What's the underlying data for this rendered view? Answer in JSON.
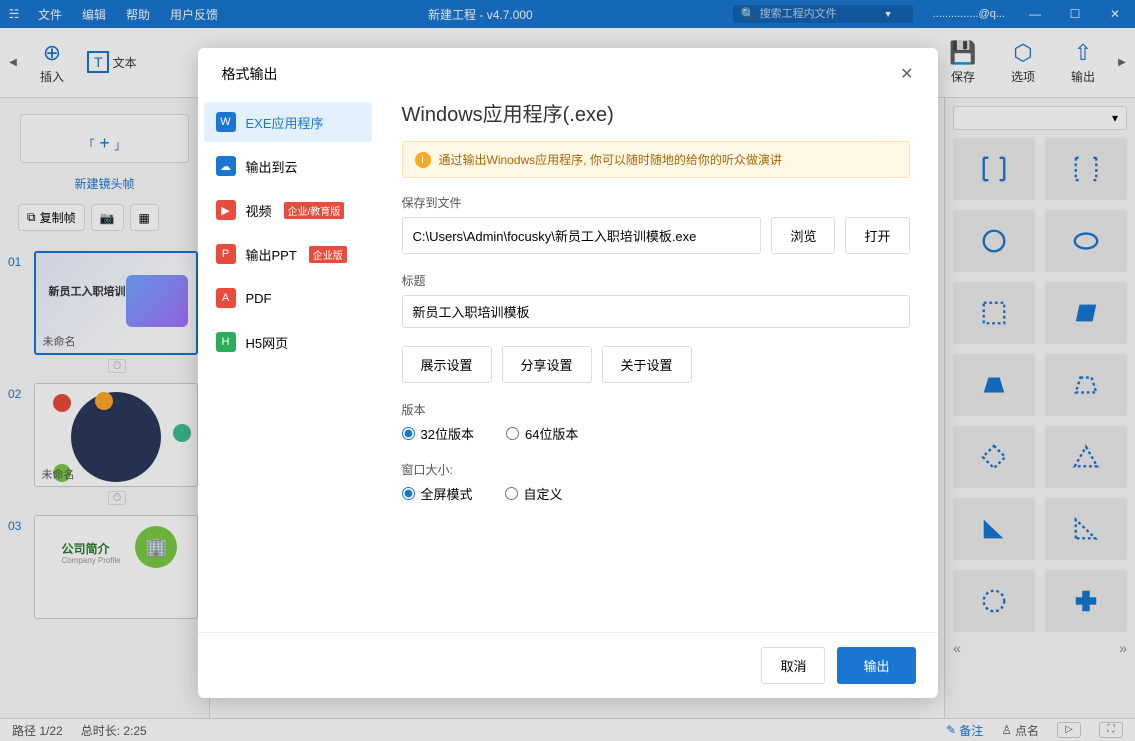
{
  "titlebar": {
    "menus": [
      "文件",
      "编辑",
      "帮助",
      "用户反馈"
    ],
    "title": "新建工程 - v4.7.000",
    "search_placeholder": "搜索工程内文件",
    "user": "...............@q..."
  },
  "toolbar": {
    "items": [
      {
        "icon": "⊕",
        "label": "插入"
      },
      {
        "icon": "T",
        "label": "文本"
      }
    ],
    "right_items": [
      {
        "icon": "💾",
        "label": "保存"
      },
      {
        "icon": "⬡",
        "label": "选项"
      },
      {
        "icon": "⇧",
        "label": "输出"
      }
    ]
  },
  "leftPanel": {
    "new_frame_label": "新建镜头帧",
    "copy_frame_btn": "复制帧",
    "slides": [
      {
        "num": "01",
        "label": "未命名",
        "title": "新员工入职培训"
      },
      {
        "num": "02",
        "label": "未命名"
      },
      {
        "num": "03",
        "title": "公司简介",
        "sub": "Company Profile"
      }
    ]
  },
  "statusbar": {
    "path": "路径 1/22",
    "duration": "总时长: 2:25",
    "remark": "备注",
    "roll": "点名"
  },
  "modal": {
    "header": "格式输出",
    "sidebar": [
      {
        "icon_bg": "#1976d2",
        "icon_txt": "W",
        "label": "EXE应用程序",
        "active": true
      },
      {
        "icon_bg": "#1976d2",
        "icon_txt": "☁",
        "label": "输出到云"
      },
      {
        "icon_bg": "#e84c3d",
        "icon_txt": "▶",
        "label": "视频",
        "tag": "企业/教育版"
      },
      {
        "icon_bg": "#e84c3d",
        "icon_txt": "P",
        "label": "输出PPT",
        "tag": "企业版"
      },
      {
        "icon_bg": "#e84c3d",
        "icon_txt": "A",
        "label": "PDF"
      },
      {
        "icon_bg": "#2aae5b",
        "icon_txt": "H",
        "label": "H5网页"
      }
    ],
    "content": {
      "title": "Windows应用程序(.exe)",
      "banner": "通过输出Winodws应用程序, 你可以随时随地的给你的听众做演讲",
      "save_label": "保存到文件",
      "save_value": "C:\\Users\\Admin\\focusky\\新员工入职培训模板.exe",
      "browse_btn": "浏览",
      "open_btn": "打开",
      "title_label": "标题",
      "title_value": "新员工入职培训模板",
      "display_settings_btn": "展示设置",
      "share_settings_btn": "分享设置",
      "about_settings_btn": "关于设置",
      "version_label": "版本",
      "version_32": "32位版本",
      "version_64": "64位版本",
      "window_label": "窗口大小:",
      "window_full": "全屏模式",
      "window_custom": "自定义"
    },
    "footer": {
      "cancel": "取消",
      "export": "输出"
    }
  }
}
